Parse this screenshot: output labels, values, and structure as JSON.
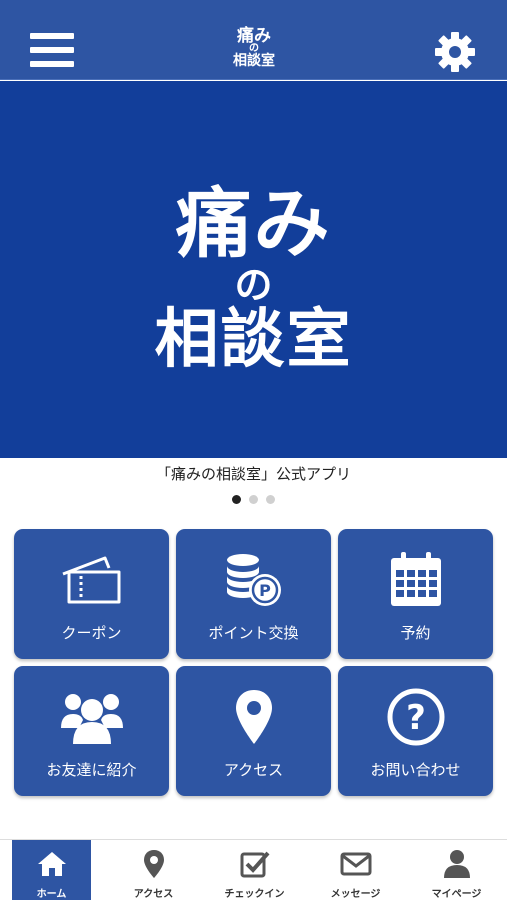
{
  "header": {
    "logo_line1": "痛み",
    "logo_line2": "の",
    "logo_line3": "相談室"
  },
  "hero": {
    "line1": "痛み",
    "line2": "の",
    "line3": "相談室",
    "background_color": "#123e9a"
  },
  "caption": "「痛みの相談室」公式アプリ",
  "carousel": {
    "count": 3,
    "active_index": 0
  },
  "tiles": [
    {
      "label": "クーポン",
      "icon": "ticket-icon"
    },
    {
      "label": "ポイント交換",
      "icon": "coins-point-icon"
    },
    {
      "label": "予約",
      "icon": "calendar-icon"
    },
    {
      "label": "お友達に紹介",
      "icon": "group-icon"
    },
    {
      "label": "アクセス",
      "icon": "map-pin-icon"
    },
    {
      "label": "お問い合わせ",
      "icon": "question-icon"
    }
  ],
  "tabbar": [
    {
      "label": "ホーム",
      "icon": "home-icon",
      "active": true
    },
    {
      "label": "アクセス",
      "icon": "map-pin-icon",
      "active": false
    },
    {
      "label": "チェックイン",
      "icon": "checkin-icon",
      "active": false
    },
    {
      "label": "メッセージ",
      "icon": "envelope-icon",
      "active": false
    },
    {
      "label": "マイページ",
      "icon": "user-icon",
      "active": false
    }
  ],
  "colors": {
    "primary": "#2e55a3",
    "hero": "#123e9a",
    "tab_inactive_icon": "#555555"
  }
}
